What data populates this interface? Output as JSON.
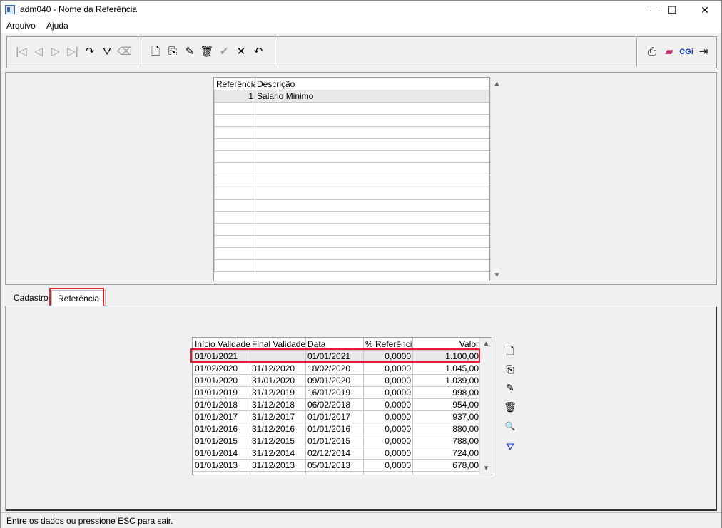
{
  "window": {
    "title": "adm040 - Nome da Referência",
    "minimize": "—",
    "maximize": "☐",
    "close": "✕"
  },
  "menu": [
    "Arquivo",
    "Ajuda"
  ],
  "toolbar": {
    "nav": [
      {
        "icon": "first-record-icon",
        "glyph": "|◁"
      },
      {
        "icon": "previous-record-icon",
        "glyph": "◁"
      },
      {
        "icon": "next-record-icon",
        "glyph": "▷"
      },
      {
        "icon": "last-record-icon",
        "glyph": "▷|"
      },
      {
        "icon": "refresh-icon",
        "glyph": "↷"
      },
      {
        "icon": "filter-icon",
        "glyph": "⛛"
      },
      {
        "icon": "clear-filter-icon",
        "glyph": "⌫"
      }
    ],
    "edit": [
      {
        "icon": "new-icon",
        "glyph": "🗋"
      },
      {
        "icon": "copy-icon",
        "glyph": "⎘"
      },
      {
        "icon": "edit-icon",
        "glyph": "✎"
      },
      {
        "icon": "delete-icon",
        "glyph": "🗑"
      },
      {
        "icon": "confirm-icon",
        "glyph": "✔"
      },
      {
        "icon": "cancel-icon",
        "glyph": "✕"
      },
      {
        "icon": "undo-icon",
        "glyph": "↶"
      }
    ],
    "right": [
      {
        "icon": "print-icon",
        "glyph": "⎙"
      },
      {
        "icon": "book-icon",
        "glyph": "▰"
      },
      {
        "icon": "cgi-icon",
        "glyph": "CGi"
      },
      {
        "icon": "exit-icon",
        "glyph": "⇥"
      }
    ]
  },
  "grid_top": {
    "headers": [
      "Referência",
      "Descrição"
    ],
    "rows": [
      [
        "1",
        "Salario Minimo"
      ]
    ]
  },
  "tabs": [
    "Cadastro",
    "Referência"
  ],
  "grid_bottom": {
    "headers": [
      "Início Validade",
      "Final Validade",
      "Data",
      "% Referência",
      "Valor"
    ],
    "rows": [
      [
        "01/01/2021",
        "",
        "01/01/2021",
        "0,0000",
        "1.100,00"
      ],
      [
        "01/02/2020",
        "31/12/2020",
        "18/02/2020",
        "0,0000",
        "1.045,00"
      ],
      [
        "01/01/2020",
        "31/01/2020",
        "09/01/2020",
        "0,0000",
        "1.039,00"
      ],
      [
        "01/01/2019",
        "31/12/2019",
        "16/01/2019",
        "0,0000",
        "998,00"
      ],
      [
        "01/01/2018",
        "31/12/2018",
        "06/02/2018",
        "0,0000",
        "954,00"
      ],
      [
        "01/01/2017",
        "31/12/2017",
        "01/01/2017",
        "0,0000",
        "937,00"
      ],
      [
        "01/01/2016",
        "31/12/2016",
        "01/01/2016",
        "0,0000",
        "880,00"
      ],
      [
        "01/01/2015",
        "31/12/2015",
        "01/01/2015",
        "0,0000",
        "788,00"
      ],
      [
        "01/01/2014",
        "31/12/2014",
        "02/12/2014",
        "0,0000",
        "724,00"
      ],
      [
        "01/01/2013",
        "31/12/2013",
        "05/01/2013",
        "0,0000",
        "678,00"
      ]
    ]
  },
  "side_buttons": [
    {
      "icon": "new-icon",
      "glyph": "🗋"
    },
    {
      "icon": "copy-icon",
      "glyph": "⎘"
    },
    {
      "icon": "edit-icon",
      "glyph": "✎"
    },
    {
      "icon": "delete-icon",
      "glyph": "🗑"
    },
    {
      "icon": "search-icon",
      "glyph": "🔍"
    },
    {
      "icon": "send-icon",
      "glyph": "⛛"
    }
  ],
  "status": "Entre os dados ou pressione ESC para sair.",
  "colors": {
    "highlight": "#e02030"
  }
}
